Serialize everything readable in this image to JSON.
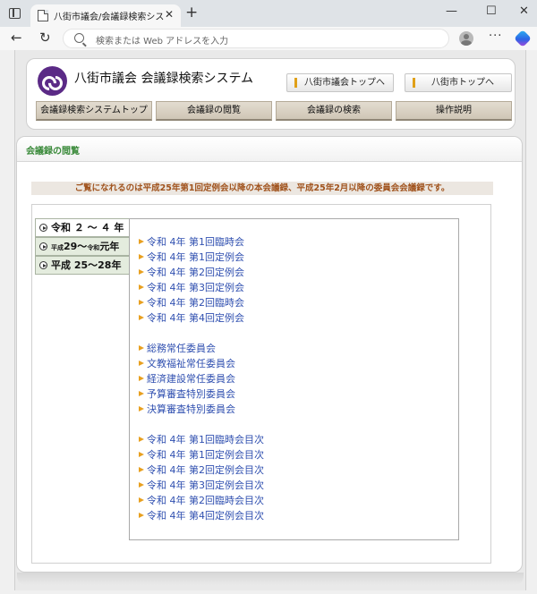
{
  "browser": {
    "tab_title": "八街市議会/会議録検索システム",
    "tab_close": "✕",
    "new_tab": "+",
    "minimize": "—",
    "maximize": "☐",
    "close": "✕",
    "back": "←",
    "reload": "↻",
    "address_placeholder": "検索または Web アドレスを入力",
    "more": "···"
  },
  "header": {
    "site_title": "八街市議会 会議録検索システム",
    "link_council_top": "八街市議会トップへ",
    "link_city_top": "八街市トップへ"
  },
  "menu": {
    "items": [
      "会議録検索システムトップ",
      "会議録の閲覧",
      "会議録の検索",
      "操作説明"
    ]
  },
  "section": {
    "title": "会議録の閲覧",
    "notice": "ご覧になれるのは平成25年第1回定例会以降の本会議録、平成25年2月以降の委員会会議録です。"
  },
  "year_nav": {
    "tab1": "令和 ２ ～ ４ 年",
    "tab2_era": "平成",
    "tab2_num": "29～",
    "tab2_era2": "令和",
    "tab2_tail": "元年",
    "tab3": "平成 25～28年"
  },
  "sessions": [
    "令和 4年 第1回臨時会",
    "令和 4年 第1回定例会",
    "令和 4年 第2回定例会",
    "令和 4年 第3回定例会",
    "令和 4年 第2回臨時会",
    "令和 4年 第4回定例会"
  ],
  "committees": [
    "総務常任委員会",
    "文教福祉常任委員会",
    "経済建設常任委員会",
    "予算審査特別委員会",
    "決算審査特別委員会"
  ],
  "indexes": [
    "令和 4年 第1回臨時会目次",
    "令和 4年 第1回定例会目次",
    "令和 4年 第2回定例会目次",
    "令和 4年 第3回定例会目次",
    "令和 4年 第2回臨時会目次",
    "令和 4年 第4回定例会目次"
  ]
}
